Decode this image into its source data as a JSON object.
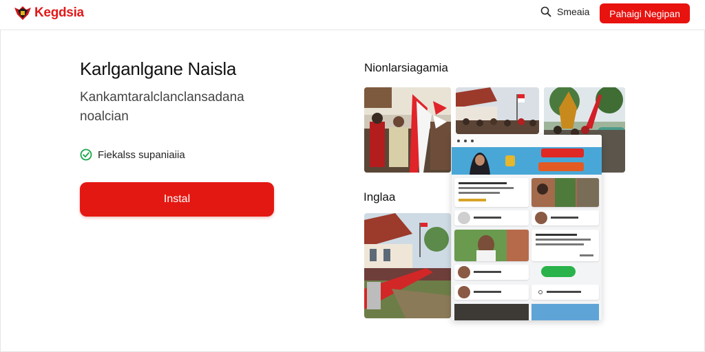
{
  "header": {
    "logo_text": "Kegdsia",
    "search_label": "Smeaia",
    "cta_label": "Pahaigi Negipan"
  },
  "hero": {
    "title": "Karlganlgane Naisla",
    "subtitle": "Kankamtaralclanclansadana noalcian",
    "feature": "Fiekalss supaniaiia",
    "install_label": "Instal"
  },
  "gallery": {
    "section_top_label": "Nionlarsiagamia",
    "section_mid_label": "Inglaa"
  },
  "colors": {
    "brand_red": "#e8120f",
    "check_green": "#1aa64a"
  }
}
